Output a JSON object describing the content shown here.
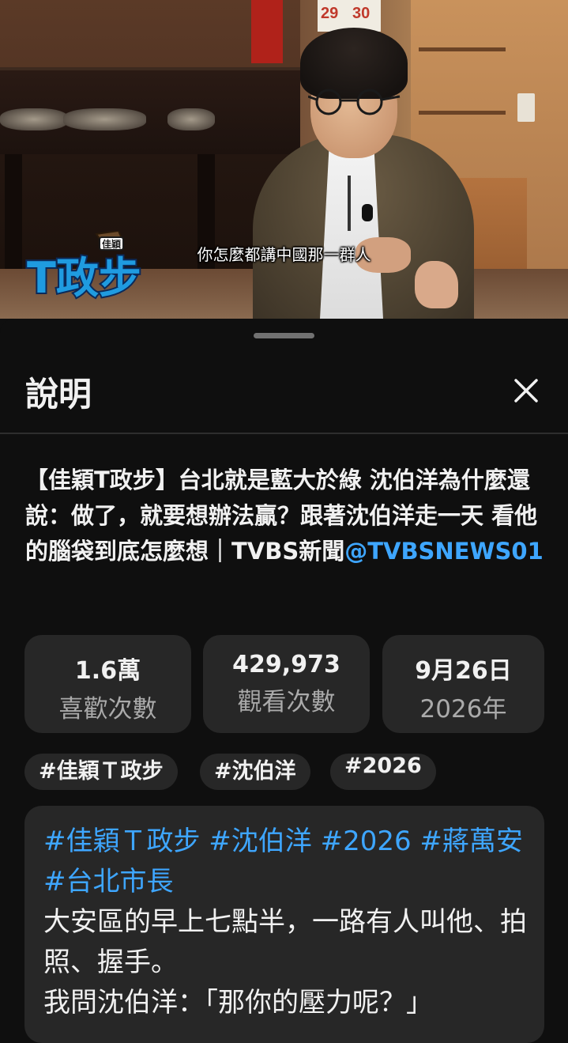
{
  "video": {
    "subtitle": "你怎麼都講中國那一群人",
    "logo_small_text": "佳穎",
    "logo_big_text": "T政步",
    "calendar_left": "29",
    "calendar_right": "30"
  },
  "sheet": {
    "title": "說明",
    "close_icon": "close-icon"
  },
  "description": {
    "title_text": "【佳穎T政步】台北就是藍大於綠 沈伯洋為什麼還說：做了，就要想辦法贏？跟著沈伯洋走一天 看他的腦袋到底怎麼想｜TVBS新聞",
    "channel_handle": "@TVBSNEWS01"
  },
  "stats": [
    {
      "value": "1.6萬",
      "label": "喜歡次數"
    },
    {
      "value": "429,973",
      "label": "觀看次數"
    },
    {
      "value": "9月26日",
      "label": "2026年"
    }
  ],
  "hashtag_chips": [
    "#佳穎Ｔ政步",
    "#沈伯洋",
    "#2026"
  ],
  "body": {
    "tags_line": "#佳穎Ｔ政步 #沈伯洋 #2026 #蔣萬安 #台北市長",
    "paragraph_1": "大安區的早上七點半，一路有人叫他、拍照、握手。",
    "paragraph_2": "我問沈伯洋：「那你的壓力呢？」"
  },
  "colors": {
    "background": "#0f0f0f",
    "card": "#272727",
    "link": "#3ea6ff",
    "secondary_text": "#aaaaaa"
  }
}
